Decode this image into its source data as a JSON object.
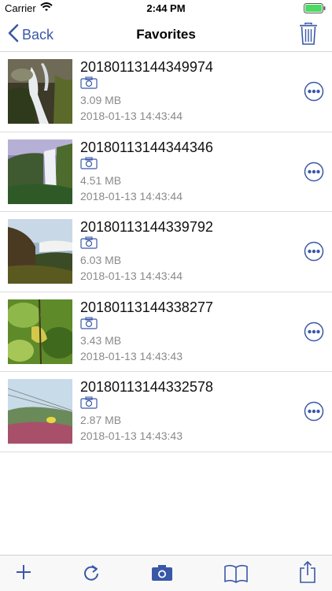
{
  "status_bar": {
    "carrier": "Carrier",
    "time": "2:44 PM"
  },
  "nav": {
    "back_label": "Back",
    "title": "Favorites"
  },
  "items": [
    {
      "name": "20180113144349974",
      "size": "3.09 MB",
      "date": "2018-01-13 14:43:44"
    },
    {
      "name": "20180113144344346",
      "size": "4.51 MB",
      "date": "2018-01-13 14:43:44"
    },
    {
      "name": "20180113144339792",
      "size": "6.03 MB",
      "date": "2018-01-13 14:43:44"
    },
    {
      "name": "20180113144338277",
      "size": "3.43 MB",
      "date": "2018-01-13 14:43:43"
    },
    {
      "name": "20180113144332578",
      "size": "2.87 MB",
      "date": "2018-01-13 14:43:43"
    }
  ],
  "icons": {
    "back": "chevron-left-icon",
    "trash": "trash-icon",
    "camera": "camera-icon",
    "more": "more-icon",
    "add": "plus-icon",
    "refresh": "refresh-icon",
    "book": "book-icon",
    "share": "share-icon"
  },
  "colors": {
    "accent": "#3a58a8",
    "battery": "#4cd964",
    "secondary_text": "#8a8a8a"
  }
}
